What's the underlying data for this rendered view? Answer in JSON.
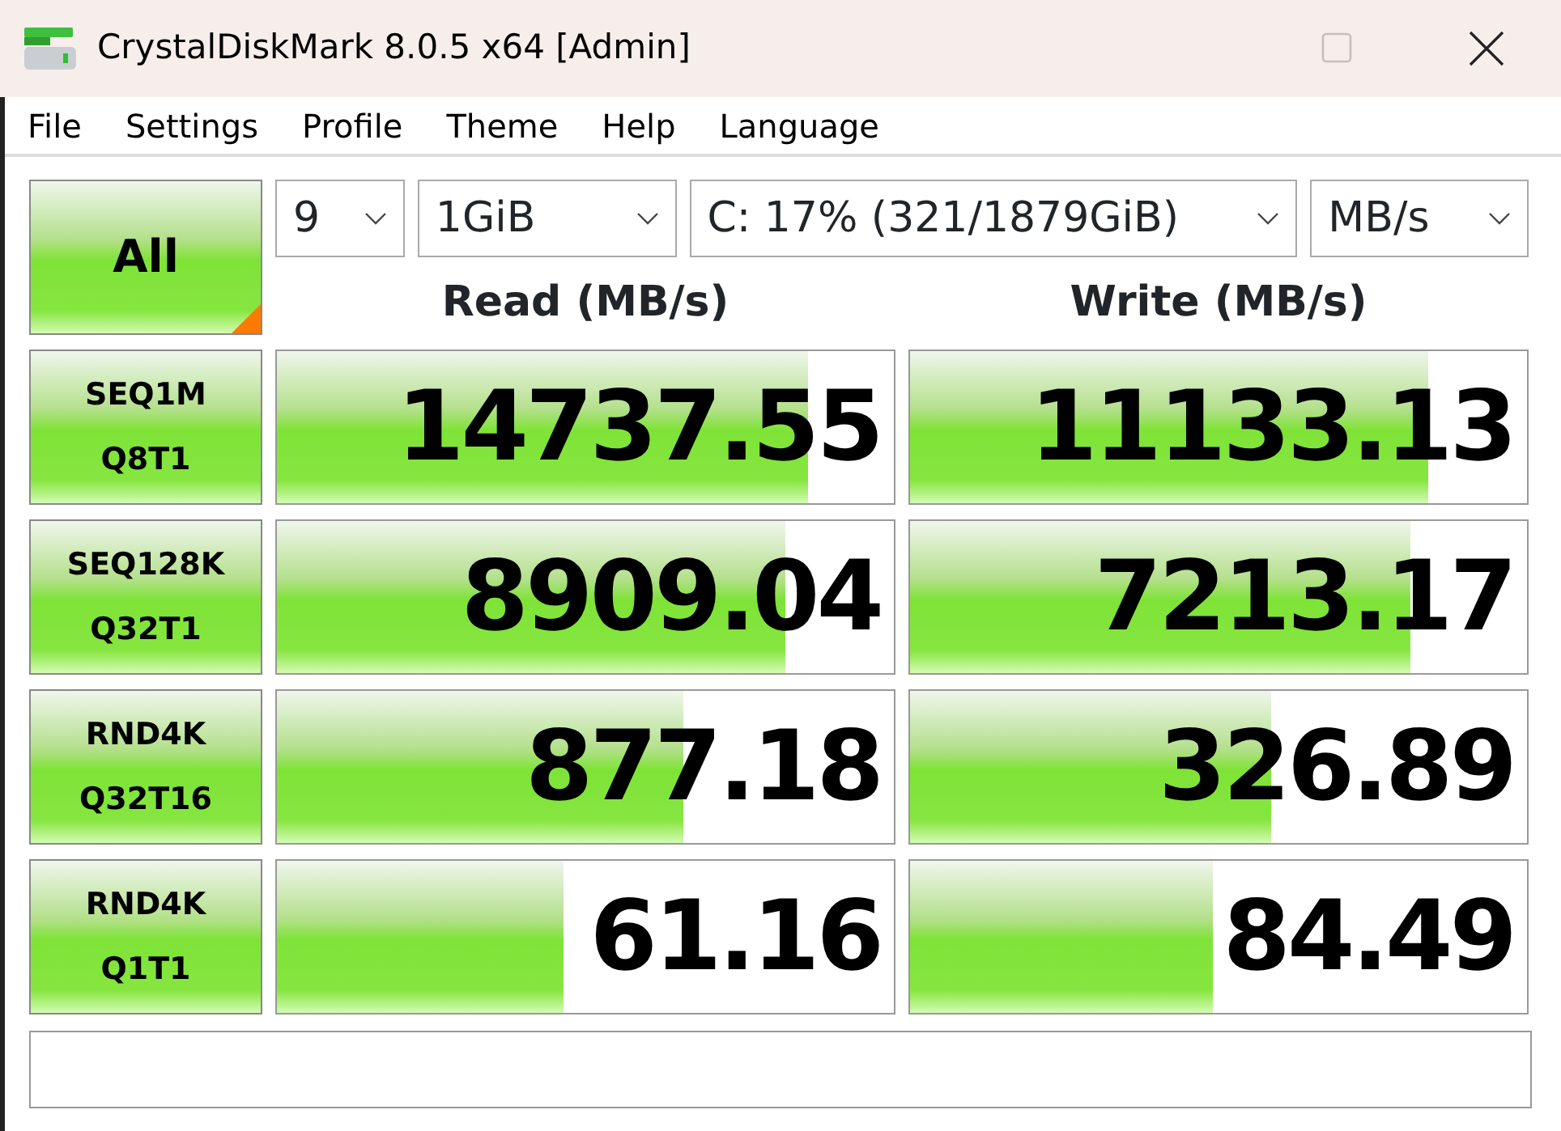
{
  "window": {
    "title": "CrystalDiskMark 8.0.5 x64 [Admin]",
    "maximize_disabled": true
  },
  "menu": [
    "File",
    "Settings",
    "Profile",
    "Theme",
    "Help",
    "Language"
  ],
  "all_button": {
    "label": "All"
  },
  "dropdowns": [
    {
      "value": "9"
    },
    {
      "value": "1GiB"
    },
    {
      "value": "C: 17% (321/1879GiB)"
    },
    {
      "value": "MB/s"
    }
  ],
  "headers": {
    "read": "Read (MB/s)",
    "write": "Write (MB/s)"
  },
  "tests": [
    {
      "name": "SEQ1M",
      "params": "Q8T1",
      "read": {
        "value": "14737.55",
        "level": 0.86
      },
      "write": {
        "value": "11133.13",
        "level": 0.84
      }
    },
    {
      "name": "SEQ128K",
      "params": "Q32T1",
      "read": {
        "value": "8909.04",
        "level": 0.825
      },
      "write": {
        "value": "7213.17",
        "level": 0.81
      }
    },
    {
      "name": "RND4K",
      "params": "Q32T16",
      "read": {
        "value": "877.18",
        "level": 0.66
      },
      "write": {
        "value": "326.89",
        "level": 0.585
      }
    },
    {
      "name": "RND4K",
      "params": "Q1T1",
      "read": {
        "value": "61.16",
        "level": 0.465
      },
      "write": {
        "value": "84.49",
        "level": 0.49
      }
    }
  ]
}
